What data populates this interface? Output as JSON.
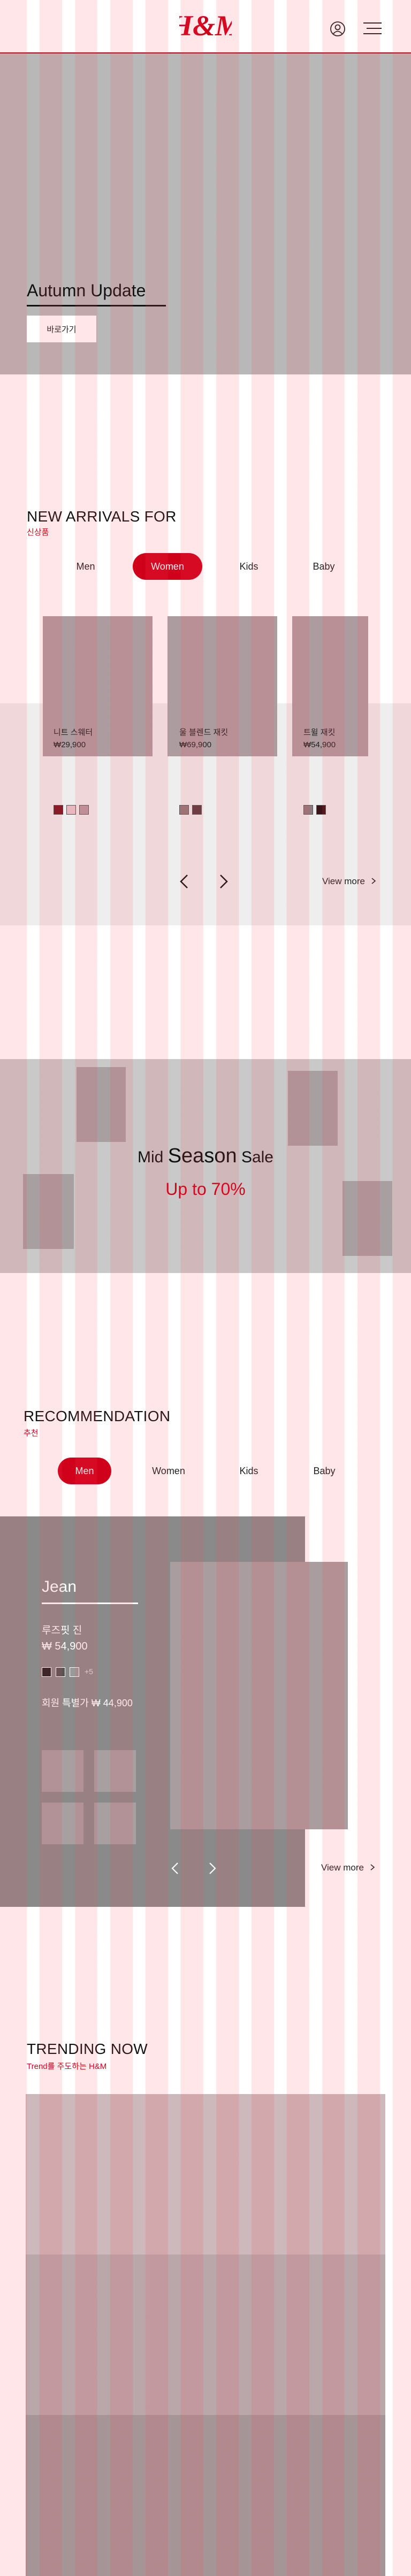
{
  "header": {
    "logo_text": "H&M",
    "colors": {
      "brand": "#d0021b"
    },
    "icons": [
      "account-icon",
      "menu-icon"
    ]
  },
  "hero": {
    "title": "Autumn Update",
    "cta_label": "바로가기"
  },
  "new_arrivals": {
    "title": "NEW ARRIVALS FOR",
    "subtitle": "신상품",
    "tabs": [
      {
        "label": "Men",
        "active": false
      },
      {
        "label": "Women",
        "active": true
      },
      {
        "label": "Kids",
        "active": false
      },
      {
        "label": "Baby",
        "active": false
      }
    ],
    "products": [
      {
        "name": "니트 스웨터",
        "price": "₩29,900",
        "swatches": [
          "#7a1620",
          "#e8b7bd",
          "#b59aa0"
        ]
      },
      {
        "name": "울 블렌드 재킷",
        "price": "₩69,900",
        "swatches": [
          "#8e7b7e",
          "#5a3c42"
        ]
      },
      {
        "name": "트윌 재킷",
        "price": "₩54,900",
        "swatches": [
          "#8e7b7e",
          "#3a1418"
        ]
      }
    ],
    "prev_icon": "chevron-left-icon",
    "next_icon": "chevron-right-icon",
    "view_more_label": "View more"
  },
  "sale": {
    "title_prefix": "Mid",
    "title_emphasis": "Season",
    "title_suffix": "Sale",
    "subtitle": "Up to 70%"
  },
  "recommendation": {
    "title": "RECOMMENDATION",
    "subtitle": "추천",
    "tabs": [
      {
        "label": "Men",
        "active": true
      },
      {
        "label": "Women",
        "active": false
      },
      {
        "label": "Kids",
        "active": false
      },
      {
        "label": "Baby",
        "active": false
      }
    ],
    "category": "Jean",
    "item_name": "루즈핏 진",
    "price": "₩ 54,900",
    "swatches": [
      "#222222",
      "#555555",
      "#999999"
    ],
    "more_colors": "+5",
    "member_price": "회원 특별가 ₩ 44,900",
    "view_more_label": "View more"
  },
  "trending": {
    "title": "TRENDING NOW",
    "subtitle": "Trend를 주도하는 H&M"
  }
}
